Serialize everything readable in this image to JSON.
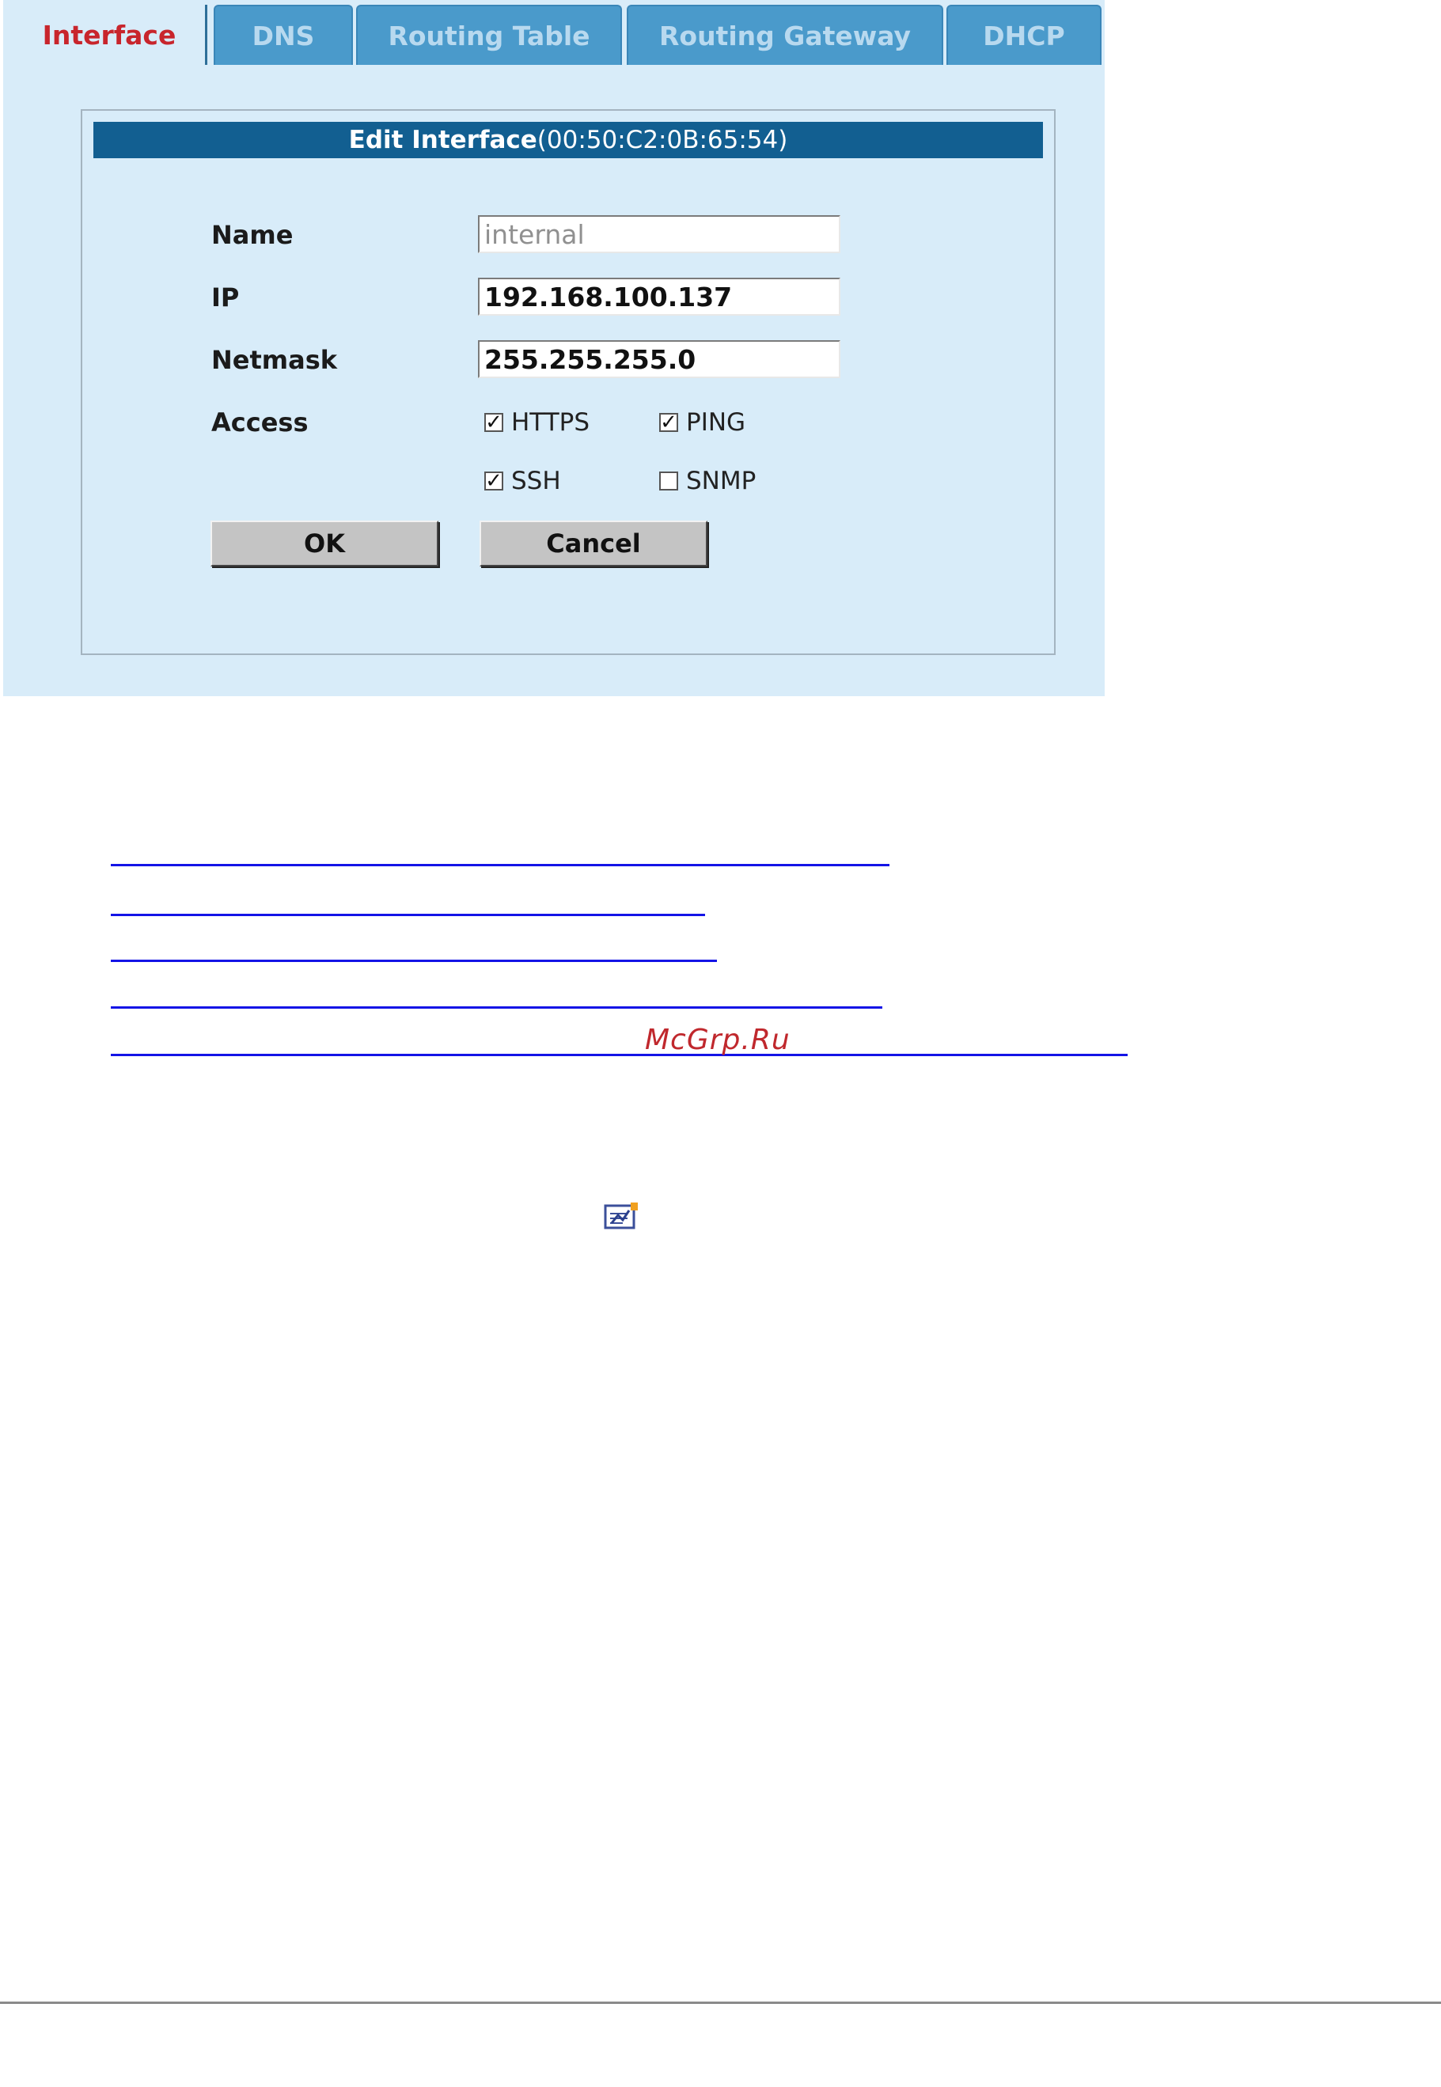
{
  "tabs": [
    {
      "label": "Interface",
      "active": true
    },
    {
      "label": "DNS",
      "active": false
    },
    {
      "label": "Routing Table",
      "active": false
    },
    {
      "label": "Routing Gateway",
      "active": false
    },
    {
      "label": "DHCP",
      "active": false
    }
  ],
  "dialog": {
    "title": "Edit Interface",
    "mac": "(00:50:C2:0B:65:54)",
    "fields": {
      "name": {
        "label": "Name",
        "value": "internal"
      },
      "ip": {
        "label": "IP",
        "value": "192.168.100.137"
      },
      "netmask": {
        "label": "Netmask",
        "value": "255.255.255.0"
      }
    },
    "access": {
      "label": "Access",
      "options": [
        {
          "label": "HTTPS",
          "checked": true
        },
        {
          "label": "PING",
          "checked": true
        },
        {
          "label": "SSH",
          "checked": true
        },
        {
          "label": "SNMP",
          "checked": false
        }
      ]
    },
    "buttons": {
      "ok": "OK",
      "cancel": "Cancel"
    }
  },
  "watermark": "McGrp.Ru",
  "colors": {
    "tab_inactive": "#4a9acb",
    "active_tab_text": "#c8252c",
    "panel_bg": "#d8ecf9",
    "header_bg": "#125f91",
    "link": "#1414e6"
  },
  "icons": {
    "edit": "edit-document-icon"
  }
}
